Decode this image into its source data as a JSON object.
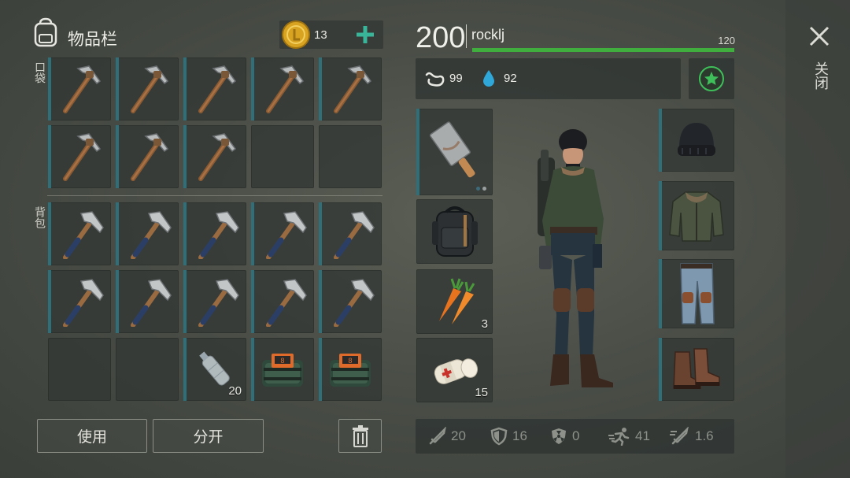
{
  "inventory": {
    "title": "物品栏",
    "coins": "13",
    "pocket_label": "口袋",
    "backpack_label": "背包",
    "pocket_slots": [
      {
        "item": "pickaxe-icon"
      },
      {
        "item": "pickaxe-icon"
      },
      {
        "item": "pickaxe-icon"
      },
      {
        "item": "pickaxe-icon"
      },
      {
        "item": "pickaxe-icon"
      },
      {
        "item": "pickaxe-icon"
      },
      {
        "item": "pickaxe-icon"
      },
      {
        "item": "pickaxe-icon"
      },
      {
        "item": ""
      },
      {
        "item": ""
      }
    ],
    "backpack_slots": [
      {
        "item": "hammer-icon"
      },
      {
        "item": "hammer-icon"
      },
      {
        "item": "hammer-icon"
      },
      {
        "item": "hammer-icon"
      },
      {
        "item": "hammer-icon"
      },
      {
        "item": "hammer-icon"
      },
      {
        "item": "hammer-icon"
      },
      {
        "item": "hammer-icon"
      },
      {
        "item": "hammer-icon"
      },
      {
        "item": "hammer-icon"
      },
      {
        "item": ""
      },
      {
        "item": ""
      },
      {
        "item": "water-bottle-icon",
        "qty": "20"
      },
      {
        "item": "bomb-icon"
      },
      {
        "item": "bomb-icon"
      }
    ],
    "use_button": "使用",
    "split_button": "分开"
  },
  "character": {
    "level": "200",
    "name": "rocklj",
    "xp": "120",
    "xp_fill": 1.0,
    "hunger": "99",
    "thirst": "92",
    "close_label": "关闭",
    "left_slots": [
      {
        "item": "cleaver-icon"
      },
      {
        "item": "backpack-icon"
      },
      {
        "item": "carrot-icon",
        "qty": "3"
      },
      {
        "item": "bandage-icon",
        "qty": "15"
      }
    ],
    "right_slots": [
      {
        "item": "beanie-icon"
      },
      {
        "item": "jacket-icon"
      },
      {
        "item": "pants-icon"
      },
      {
        "item": "boots-icon"
      }
    ],
    "stats": {
      "attack": "20",
      "defense": "16",
      "radiation": "0",
      "speed": "41",
      "attack_speed": "1.6"
    }
  },
  "colors": {
    "accent_teal": "#2f6f7a",
    "plus_green": "#39b59a",
    "xp_green": "#3fae3f",
    "star_green": "#3fbf5a"
  }
}
